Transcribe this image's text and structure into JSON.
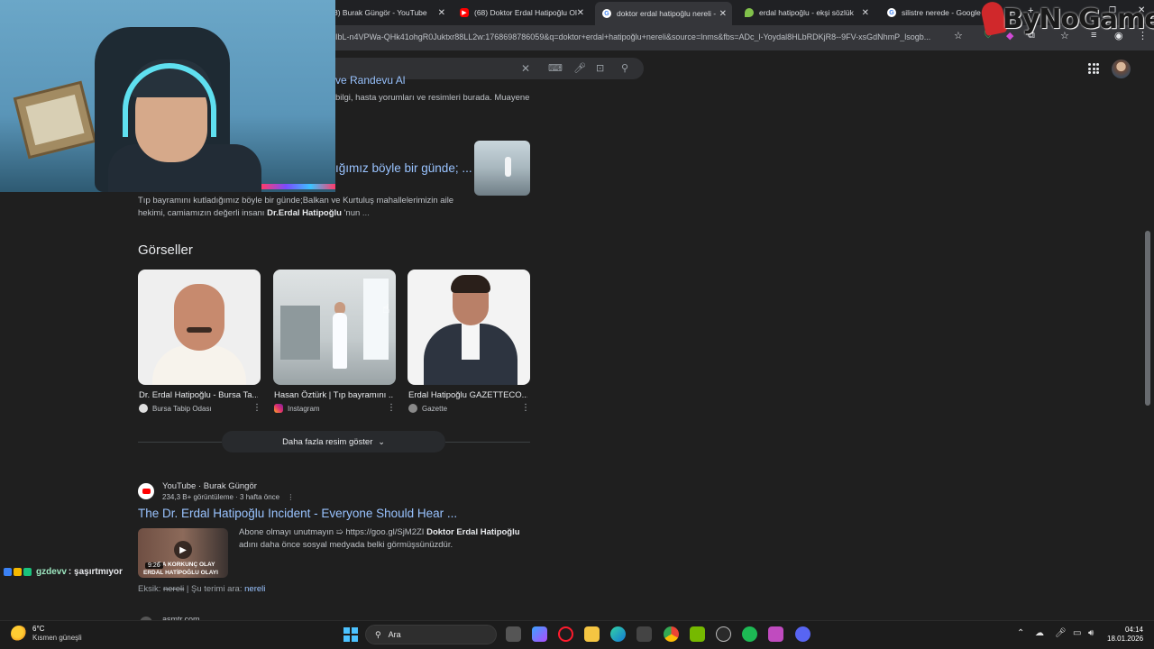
{
  "browser": {
    "tabs": [
      {
        "label": "8) Burak Güngör - YouTube",
        "icon": "youtube-icon"
      },
      {
        "label": "(68) Doktor Erdal Hatipoğlu Ol",
        "icon": "youtube-icon"
      },
      {
        "label": "doktor erdal hatipoğlu nereli -",
        "icon": "google-icon",
        "active": true
      },
      {
        "label": "erdal hatipoğlu - ekşi sözlük",
        "icon": "eksi-icon"
      },
      {
        "label": "silistre nerede - Google",
        "icon": "google-icon"
      }
    ],
    "url": "IbL-n4VPWa-QHk41ohgR0Juktxr88LL2w:1768698786059&q=doktor+erdal+hatipoğlu+nereli&source=lnms&fbs=ADc_l-Yoydal8HLbRDKjR8--9FV-xsGdNhmP_lsogb..."
  },
  "overlay": {
    "logo": "ByNoGame"
  },
  "results": {
    "partial_title": "ve Randevu Al",
    "partial_snippet": "bilgi, hasta yorumları ve resimleri burada. Muayene",
    "second_title": "ığımız böyle bir günde; ...",
    "second_snippet": {
      "line1": "Tıp bayramını kutladığımız böyle bir günde;Balkan ve Kurtuluş mahallelerimizin aile",
      "line2_pre": "hekimi, camiamızın değerli insanı ",
      "line2_bold": "Dr.Erdal Hatipoğlu",
      "line2_post": " 'nun ",
      "line2_ell": "..."
    }
  },
  "images": {
    "heading": "Görseller",
    "cards": [
      {
        "title": "Dr. Erdal Hatipoğlu - Bursa Ta...",
        "source": "Bursa Tabip Odası",
        "source_color": "#e0e0e0"
      },
      {
        "title": "Hasan Öztürk | Tıp bayramını ...",
        "source": "Instagram",
        "source_color": "#e1306c"
      },
      {
        "title": "Erdal Hatipoğlu GAZETTECO...",
        "source": "Gazette",
        "source_color": "#8a8a8a"
      }
    ],
    "more_button": "Daha fazla resim göster"
  },
  "video": {
    "source": "YouTube · Burak Güngör",
    "meta": "234,3 B+ görüntüleme · 3 hafta önce",
    "title": "The Dr. Erdal Hatipoğlu Incident - Everyone Should Hear ...",
    "snippet_pre": "Abone olmayı unutmayın ➯ https://goo.gl/SjM2ZI ",
    "snippet_bold": "Doktor Erdal Hatipoğlu",
    "snippet_line2": "adını daha önce sosyal medyada belki görmüşsünüzdür.",
    "duration": "9:26",
    "thumb_caption_1": "DA KORKUNÇ OLAY",
    "thumb_caption_2": "ERDAL HATİPOĞLU OLAYI",
    "missing_prefix": "Eksik: ",
    "missing_word": "nereli",
    "missing_mid": " | Şu terimi ara: ",
    "missing_link": "nereli"
  },
  "next_result": "asmtr.com",
  "chat": {
    "user": "gzdevv",
    "message": " : şaşırtmıyor"
  },
  "taskbar": {
    "temperature": "6°C",
    "condition": "Kısmen güneşli",
    "search_label": "Ara",
    "time": "04:14",
    "date": "18.01.2026"
  }
}
